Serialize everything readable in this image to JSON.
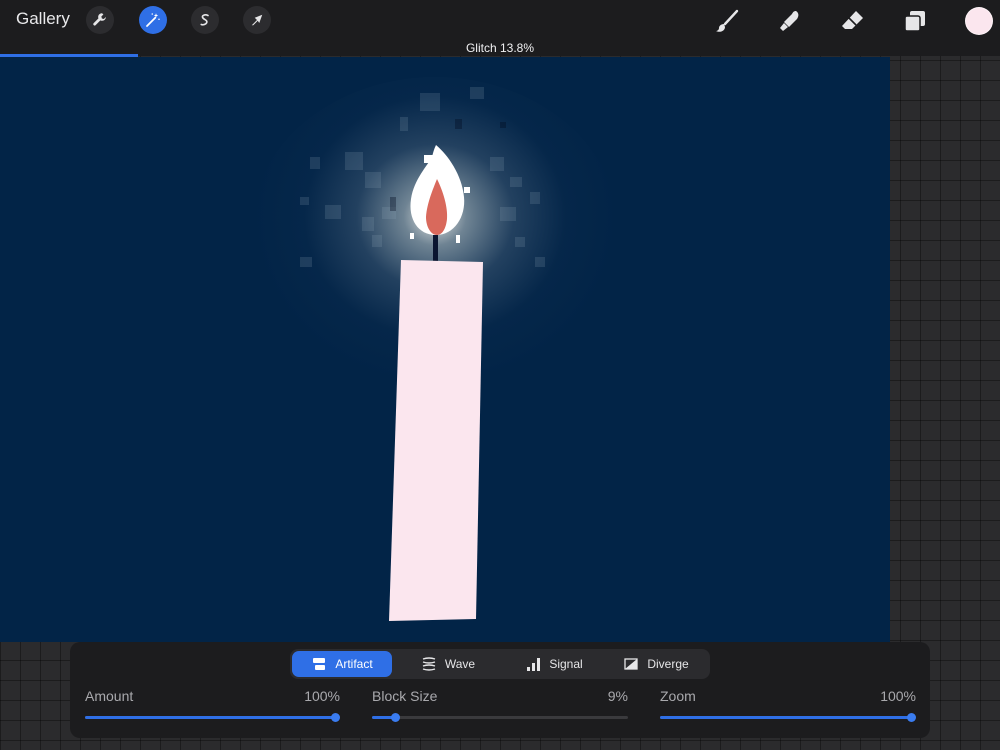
{
  "topbar": {
    "gallery_label": "Gallery",
    "color_swatch": "#fbe6ee"
  },
  "filter": {
    "title": "Glitch 13.8%",
    "progress": 0.138
  },
  "tabs": [
    {
      "label": "Artifact",
      "icon": "artifact-icon",
      "active": true
    },
    {
      "label": "Wave",
      "icon": "wave-icon",
      "active": false
    },
    {
      "label": "Signal",
      "icon": "signal-bars-icon",
      "active": false
    },
    {
      "label": "Diverge",
      "icon": "diverge-icon",
      "active": false
    }
  ],
  "sliders": [
    {
      "label": "Amount",
      "value": "100%",
      "fraction": 1.0
    },
    {
      "label": "Block Size",
      "value": "9%",
      "fraction": 0.09
    },
    {
      "label": "Zoom",
      "value": "100%",
      "fraction": 1.0
    }
  ],
  "colors": {
    "accent": "#2f6fe6",
    "canvas_background": "#022447",
    "candle": "#fbe6ee",
    "flame_inner": "#d9695c"
  }
}
